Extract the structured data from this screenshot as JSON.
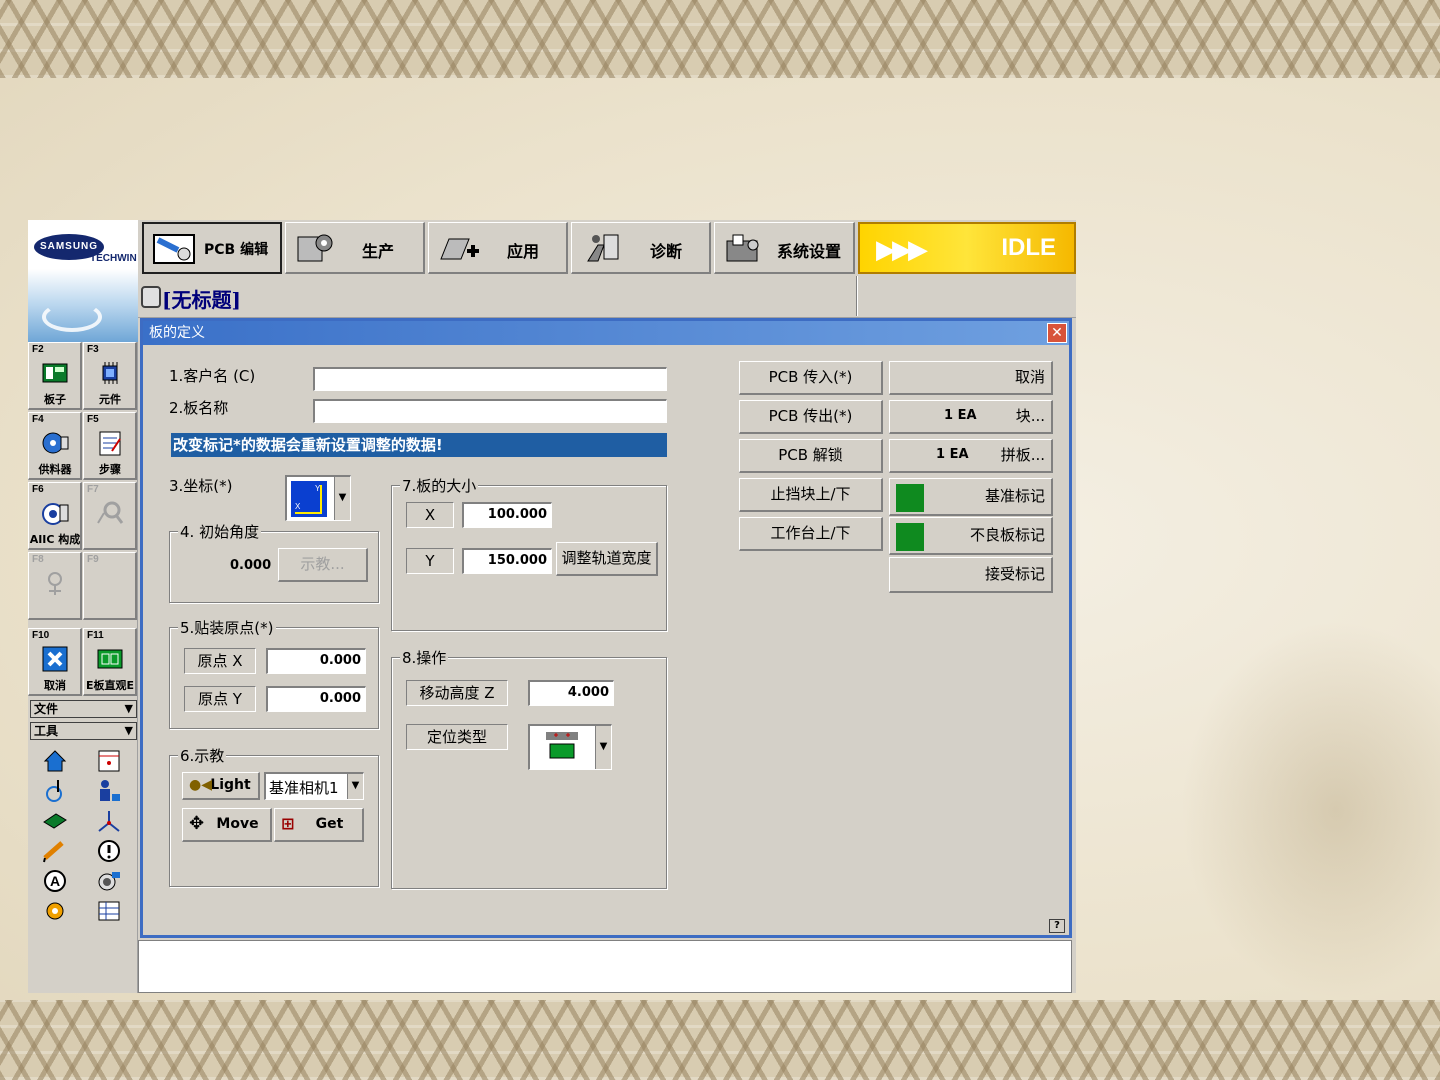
{
  "app": {
    "brand": "SAMSUNG",
    "brand_sub": "TECHWIN",
    "doc_title": "[无标题]",
    "status": "IDLE",
    "accent_color": "#3d6cc3",
    "idle_color": "#ffd400"
  },
  "nav": {
    "tabs": [
      {
        "label": "PCB 编辑",
        "icon": "pcb-edit-icon",
        "active": true
      },
      {
        "label": "生产",
        "icon": "production-gear-icon",
        "active": false
      },
      {
        "label": "应用",
        "icon": "application-icon",
        "active": false
      },
      {
        "label": "诊断",
        "icon": "diagnosis-icon",
        "active": false
      },
      {
        "label": "系统设置",
        "icon": "system-settings-icon",
        "active": false
      }
    ]
  },
  "sidebar": {
    "fkeys": [
      {
        "code": "F2",
        "label": "板子",
        "icon": "board-icon",
        "enabled": true
      },
      {
        "code": "F3",
        "label": "元件",
        "icon": "component-icon",
        "enabled": true
      },
      {
        "code": "F4",
        "label": "供料器",
        "icon": "feeder-icon",
        "enabled": true
      },
      {
        "code": "F5",
        "label": "步骤",
        "icon": "steps-icon",
        "enabled": true
      },
      {
        "code": "F6",
        "label": "AIIC 构成",
        "icon": "aiic-icon",
        "enabled": true
      },
      {
        "code": "F7",
        "label": "",
        "icon": "search-icon",
        "enabled": false
      },
      {
        "code": "F8",
        "label": "",
        "icon": "nozzle-icon",
        "enabled": false
      },
      {
        "code": "F9",
        "label": "",
        "icon": "",
        "enabled": false
      },
      {
        "code": "F10",
        "label": "取消",
        "icon": "cancel-icon",
        "enabled": true
      },
      {
        "code": "F11",
        "label": "E板直观E",
        "icon": "board-view-icon",
        "enabled": true
      }
    ],
    "menus": [
      {
        "label": "文件"
      },
      {
        "label": "工具"
      }
    ],
    "tools": [
      "home-icon",
      "calendar-icon",
      "rotate-icon",
      "operator-icon",
      "conveyor-icon",
      "axis-icon",
      "syringe-icon",
      "alert-icon",
      "letter-a-icon",
      "camera-icon",
      "gear-icon",
      "table-icon"
    ]
  },
  "dialog": {
    "title": "板的定义",
    "customer_label": "1.客户名 (C)",
    "customer_value": "",
    "board_name_label": "2.板名称",
    "board_name_value": "",
    "banner": "改变标记*的数据会重新设置调整的数据!",
    "coord_label": "3.坐标(*)",
    "angle_group": "4. 初始角度",
    "angle_value": "0.000",
    "teach_btn": "示教...",
    "origin_group": "5.贴装原点(*)",
    "origin_x_label": "原点 X",
    "origin_x_value": "0.000",
    "origin_y_label": "原点 Y",
    "origin_y_value": "0.000",
    "teach_group": "6.示教",
    "light_btn": "Light",
    "camera_select": "基准相机1",
    "move_btn": "Move",
    "get_btn": "Get",
    "size_group": "7.板的大小",
    "size_x_label": "X",
    "size_x_value": "100.000",
    "size_y_label": "Y",
    "size_y_value": "150.000",
    "adjust_width_btn": "调整轨道宽度",
    "op_group": "8.操作",
    "move_height_label": "移动高度 Z",
    "move_height_value": "4.000",
    "locate_type_label": "定位类型",
    "help": "?"
  },
  "actions": {
    "pcb_in": "PCB 传入(*)",
    "pcb_out": "PCB 传出(*)",
    "pcb_unlock": "PCB 解锁",
    "stopper": "止挡块上/下",
    "table": "工作台上/下",
    "cancel": "取消",
    "block_count": "1 EA",
    "block_label": "块...",
    "panel_count": "1 EA",
    "panel_label": "拼板...",
    "fiducial": "基准标记",
    "bad_mark": "不良板标记",
    "accept_mark": "接受标记",
    "mark_color": "#0f8a1f"
  }
}
